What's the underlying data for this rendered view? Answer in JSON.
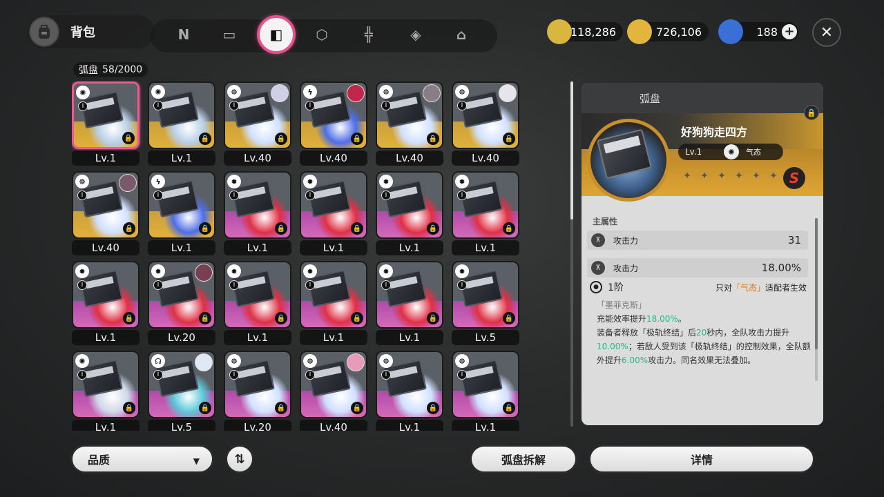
{
  "header": {
    "title": "背包",
    "tabs": [
      {
        "name": "tab-n",
        "icon": "n-icon",
        "glyph": "N",
        "active": false
      },
      {
        "name": "tab-console",
        "icon": "gameboy-icon",
        "glyph": "▭",
        "active": false
      },
      {
        "name": "tab-disc",
        "icon": "disc-drive-icon",
        "glyph": "◧",
        "active": true
      },
      {
        "name": "tab-cube",
        "icon": "cube-icon",
        "glyph": "⬡",
        "active": false
      },
      {
        "name": "tab-food",
        "icon": "utensils-icon",
        "glyph": "╬",
        "active": false
      },
      {
        "name": "tab-diamond",
        "icon": "diamond-icon",
        "glyph": "◈",
        "active": false
      },
      {
        "name": "tab-home",
        "icon": "home-icon",
        "glyph": "⌂",
        "active": false
      }
    ],
    "currencies": [
      {
        "name": "coin",
        "icon": "gold-coin-icon",
        "value": "118,286",
        "color": "#d9b640"
      },
      {
        "name": "ticket",
        "icon": "ticket-icon",
        "value": "726,106",
        "color": "#e3b53c"
      },
      {
        "name": "polychrome",
        "icon": "polychrome-icon",
        "value": "188",
        "color": "#3a6fd8"
      }
    ],
    "close_glyph": "✕",
    "plus_glyph": "+"
  },
  "inventory": {
    "label": "弧盘",
    "count": "58/2000",
    "items": [
      {
        "rank": "S",
        "level": "Lv.1",
        "attr": "✺",
        "avatar": null,
        "selected": true,
        "disc": "#b8cfe6"
      },
      {
        "rank": "S",
        "level": "Lv.1",
        "attr": "✺",
        "avatar": null,
        "selected": false,
        "disc": "#b8cfe6"
      },
      {
        "rank": "S",
        "level": "Lv.40",
        "attr": "☸",
        "avatar": "#cfcfe8",
        "selected": false,
        "disc": "#d0e0ff"
      },
      {
        "rank": "S",
        "level": "Lv.40",
        "attr": "ϟ",
        "avatar": "#c2264a",
        "selected": false,
        "disc": "#4e6ee8"
      },
      {
        "rank": "S",
        "level": "Lv.40",
        "attr": "☸",
        "avatar": "#8b7d86",
        "selected": false,
        "disc": "#d0e0ff"
      },
      {
        "rank": "S",
        "level": "Lv.40",
        "attr": "☸",
        "avatar": "#e6e6ea",
        "selected": false,
        "disc": "#d0e0ff"
      },
      {
        "rank": "S",
        "level": "Lv.40",
        "attr": "☸",
        "avatar": "#7a5a6a",
        "selected": false,
        "disc": "#d0e0ff"
      },
      {
        "rank": "S",
        "level": "Lv.1",
        "attr": "ϟ",
        "avatar": null,
        "selected": false,
        "disc": "#4e6ee8"
      },
      {
        "rank": "A",
        "level": "Lv.1",
        "attr": "✹",
        "avatar": null,
        "selected": false,
        "disc": "#e03045"
      },
      {
        "rank": "A",
        "level": "Lv.1",
        "attr": "✹",
        "avatar": null,
        "selected": false,
        "disc": "#e03045"
      },
      {
        "rank": "A",
        "level": "Lv.1",
        "attr": "✹",
        "avatar": null,
        "selected": false,
        "disc": "#e03045"
      },
      {
        "rank": "A",
        "level": "Lv.1",
        "attr": "✹",
        "avatar": null,
        "selected": false,
        "disc": "#e03045"
      },
      {
        "rank": "A",
        "level": "Lv.1",
        "attr": "✹",
        "avatar": null,
        "selected": false,
        "disc": "#e03045"
      },
      {
        "rank": "A",
        "level": "Lv.20",
        "attr": "✹",
        "avatar": "#7a3e52",
        "selected": false,
        "disc": "#e03045"
      },
      {
        "rank": "A",
        "level": "Lv.1",
        "attr": "✹",
        "avatar": null,
        "selected": false,
        "disc": "#e03045"
      },
      {
        "rank": "A",
        "level": "Lv.1",
        "attr": "✹",
        "avatar": null,
        "selected": false,
        "disc": "#e03045"
      },
      {
        "rank": "A",
        "level": "Lv.1",
        "attr": "✹",
        "avatar": null,
        "selected": false,
        "disc": "#e03045"
      },
      {
        "rank": "A",
        "level": "Lv.5",
        "attr": "✹",
        "avatar": null,
        "selected": false,
        "disc": "#e03045"
      },
      {
        "rank": "A",
        "level": "Lv.1",
        "attr": "✺",
        "avatar": null,
        "selected": false,
        "disc": "#cfd8e8"
      },
      {
        "rank": "A",
        "level": "Lv.5",
        "attr": "☊",
        "avatar": "#dfe8f5",
        "selected": false,
        "disc": "#5ac6d8"
      },
      {
        "rank": "A",
        "level": "Lv.20",
        "attr": "☸",
        "avatar": null,
        "selected": false,
        "disc": "#d0e0ff"
      },
      {
        "rank": "A",
        "level": "Lv.40",
        "attr": "☸",
        "avatar": "#e89ab8",
        "selected": false,
        "disc": "#d0e0ff"
      },
      {
        "rank": "A",
        "level": "Lv.1",
        "attr": "☸",
        "avatar": null,
        "selected": false,
        "disc": "#d0e0ff"
      },
      {
        "rank": "A",
        "level": "Lv.1",
        "attr": "☸",
        "avatar": null,
        "selected": false,
        "disc": "#d0e0ff"
      }
    ],
    "rank_glyph": "I",
    "lock_glyph": "🔒"
  },
  "detail": {
    "category": "弧盘",
    "name": "好狗狗走四方",
    "level": "Lv.1",
    "attr_glyph": "✺",
    "attr_name": "气态",
    "stars": [
      "✦",
      "✦",
      "✦",
      "✦",
      "✦",
      "✦",
      "✦"
    ],
    "rank_badge": "S",
    "main_stat_label": "主属性",
    "stats": [
      {
        "icon": "attack-icon",
        "glyph": "⊼",
        "name": "攻击力",
        "value": "31"
      },
      {
        "icon": "attack-icon",
        "glyph": "⊼",
        "name": "攻击力",
        "value": "18.00%"
      }
    ],
    "tier": "1阶",
    "condition_prefix": "只对",
    "condition_attr": "「气态」",
    "condition_suffix": "适配者生效",
    "effect_name": "「墨菲克斯」",
    "effect_p1a": "充能效率提升",
    "effect_p1b": "18.00%",
    "effect_p1c": "。",
    "effect_p2a": "装备者释放「极轨终结」后",
    "effect_p2b": "20",
    "effect_p2c": "秒内，全队攻击力提升",
    "effect_p2d": "10.00%",
    "effect_p2e": "；若敌人受到该「极轨终结」的控制效果，全队额外提升",
    "effect_p2f": "6.00%",
    "effect_p2g": "攻击力。同名效果无法叠加。"
  },
  "bottom": {
    "filter_label": "品质",
    "filter_caret": "▼",
    "sort_glyph": "⇅",
    "dismantle_label": "弧盘拆解",
    "details_label": "详情"
  }
}
